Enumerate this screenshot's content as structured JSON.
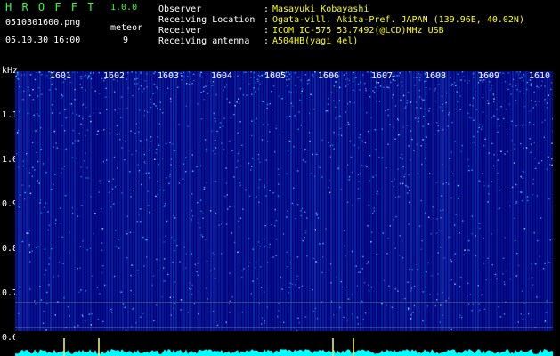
{
  "header": {
    "app_name": "H R O F F T",
    "version": "1.0.0",
    "filename": "0510301600.png",
    "datetime": "05.10.30 16:00",
    "meteor_label": "meteor",
    "meteor_count": "9"
  },
  "info": {
    "rows": [
      {
        "key": "Observer",
        "sep": ":",
        "value": "Masayuki Kobayashi"
      },
      {
        "key": "Receiving Location",
        "sep": ":",
        "value": "Ogata-vill. Akita-Pref. JAPAN (139.96E, 40.02N)"
      },
      {
        "key": "Receiver",
        "sep": ":",
        "value": "ICOM IC-575 53.7492(@LCD)MHz USB"
      },
      {
        "key": "Receiving antenna",
        "sep": ":",
        "value": "A504HB(yagi 4el)"
      }
    ]
  },
  "chart_data": {
    "type": "heatmap",
    "ylabel": "kHz",
    "yticks": [
      "1.1",
      "1.0",
      "0.9",
      "0.8",
      "0.7",
      "0.6"
    ],
    "xticks": [
      "1601",
      "1602",
      "1603",
      "1604",
      "1605",
      "1606",
      "1607",
      "1608",
      "1609",
      "1610"
    ],
    "grid": false,
    "colors": {
      "background": "#00007a",
      "signal": "#3aa0ff",
      "hot": "#ffff66",
      "amplitude": "#00ffff",
      "axis": "#ffffff"
    }
  },
  "colors": {
    "title_green": "#33ff33",
    "label_white": "#ffffff",
    "highlight_yellow": "#ffff00"
  }
}
